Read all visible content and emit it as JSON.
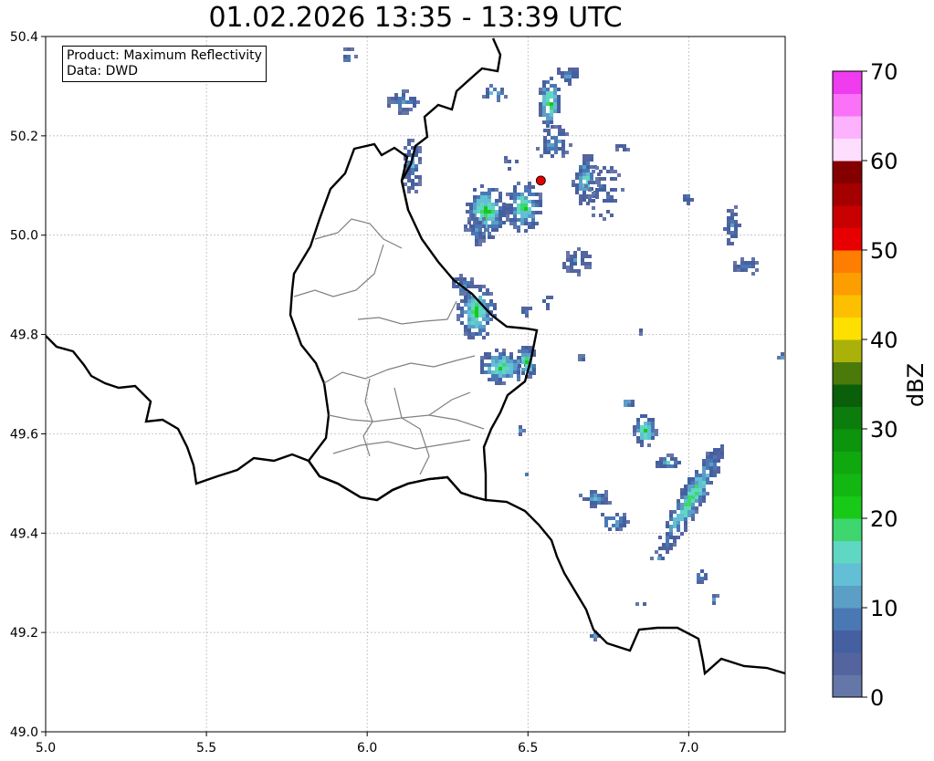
{
  "title": "01.02.2026 13:35 - 13:39 UTC",
  "info": {
    "product": "Product: Maximum Reflectivity",
    "data": "Data: DWD"
  },
  "axes": {
    "x_range": [
      5.0,
      7.3
    ],
    "y_range": [
      49.0,
      50.4
    ],
    "x_ticks": [
      "5.0",
      "5.5",
      "6.0",
      "6.5",
      "7.0"
    ],
    "y_ticks": [
      "49.0",
      "49.2",
      "49.4",
      "49.6",
      "49.8",
      "50.0",
      "50.2",
      "50.4"
    ],
    "x_tick_values": [
      5.0,
      5.5,
      6.0,
      6.5,
      7.0
    ],
    "y_tick_values": [
      49.0,
      49.2,
      49.4,
      49.6,
      49.8,
      50.0,
      50.2,
      50.4
    ],
    "grid": true
  },
  "marker": {
    "lon": 6.54,
    "lat": 50.11,
    "color": "#e00000"
  },
  "colorbar": {
    "label": "dBZ",
    "tick_labels": [
      "0",
      "10",
      "20",
      "30",
      "40",
      "50",
      "60",
      "70"
    ],
    "tick_values": [
      0,
      10,
      20,
      30,
      40,
      50,
      60,
      70
    ],
    "range": [
      0,
      70
    ],
    "step": 2.5,
    "colors": [
      "#6577a8",
      "#53649f",
      "#4560a0",
      "#4a78b4",
      "#5b9ec6",
      "#62bfd6",
      "#5fd7c2",
      "#3ed66e",
      "#18c918",
      "#12b712",
      "#0fa80f",
      "#0c940c",
      "#0c7d0c",
      "#0a5f0a",
      "#4a7a0a",
      "#aab20a",
      "#fde000",
      "#fdc000",
      "#fd9e00",
      "#fd7e00",
      "#e80000",
      "#c80000",
      "#a40000",
      "#840000",
      "#fedeff",
      "#fdb2fd",
      "#fa72f8",
      "#ee3cee"
    ]
  },
  "chart_data": {
    "type": "heatmap",
    "title": "01.02.2026 13:35 - 13:39 UTC",
    "xlabel": "",
    "ylabel": "",
    "xlim": [
      5.0,
      7.3
    ],
    "ylim": [
      49.0,
      50.4
    ],
    "colorbar_label": "dBZ",
    "cells": [
      {
        "lon": 6.38,
        "lat": 50.06,
        "dbz": 22
      },
      {
        "lon": 6.47,
        "lat": 50.05,
        "dbz": 21
      },
      {
        "lon": 6.6,
        "lat": 50.28,
        "dbz": 22
      },
      {
        "lon": 6.65,
        "lat": 50.13,
        "dbz": 18
      },
      {
        "lon": 6.33,
        "lat": 49.83,
        "dbz": 22
      },
      {
        "lon": 6.47,
        "lat": 49.74,
        "dbz": 21
      },
      {
        "lon": 6.86,
        "lat": 49.6,
        "dbz": 22
      },
      {
        "lon": 7.02,
        "lat": 49.44,
        "dbz": 20
      },
      {
        "lon": 6.75,
        "lat": 50.02,
        "dbz": 10
      },
      {
        "lon": 7.1,
        "lat": 49.98,
        "dbz": 10
      },
      {
        "lon": 6.68,
        "lat": 49.42,
        "dbz": 12
      },
      {
        "lon": 6.57,
        "lat": 49.47,
        "dbz": 10
      },
      {
        "lon": 6.24,
        "lat": 50.25,
        "dbz": 10
      },
      {
        "lon": 6.96,
        "lat": 50.07,
        "dbz": 8
      }
    ]
  }
}
